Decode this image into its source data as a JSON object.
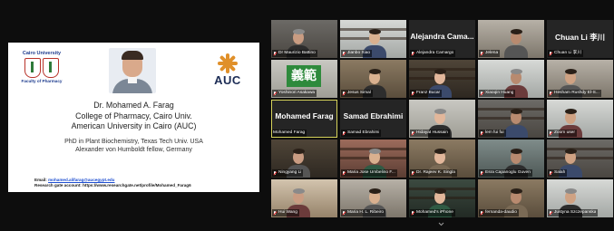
{
  "slide": {
    "cairo_logo_top": "Cairo University",
    "cairo_logo_bottom": "Faculty of Pharmacy",
    "auc_logo": "AUC",
    "name": "Dr. Mohamed A. Farag",
    "affil1": "College of Pharmacy, Cairo Univ.",
    "affil2": "American University in Cairo (AUC)",
    "edu1": "PhD in Plant Biochemistry, Texas Tech Univ. USA",
    "edu2": "Alexander von Humboldt fellow, Germany",
    "email_label": "Email:",
    "email": "mohamed.alifarag@aucegypt.edu",
    "research_label": "Research gate account:",
    "research_url": "https://www.researchgate.net/profile/Mohamed_Farag6"
  },
  "tiles": [
    {
      "name": "Dr Maurizio Battino",
      "display_name": "",
      "muted": true
    },
    {
      "name": "Jianbo Xiao",
      "display_name": "",
      "muted": true
    },
    {
      "name": "Alejandra Camargo",
      "display_name": "Alejandra Cama...",
      "muted": true
    },
    {
      "name": "Jelena",
      "display_name": "",
      "muted": true
    },
    {
      "name": "Chuan Li 李川",
      "display_name": "Chuan Li 李川",
      "muted": true
    },
    {
      "name": "Yoshinori Asakawa",
      "display_name": "",
      "muted": true,
      "sign_text": "義範"
    },
    {
      "name": "Jesus Simal",
      "display_name": "",
      "muted": true
    },
    {
      "name": "Franz Bucar",
      "display_name": "",
      "muted": true
    },
    {
      "name": "Xiaoqin Huang",
      "display_name": "",
      "muted": true
    },
    {
      "name": "Hesham Rushdy El-S...",
      "display_name": "",
      "muted": true
    },
    {
      "name": "Mohamed Farag",
      "display_name": "Mohamed Farag",
      "muted": false,
      "active": true
    },
    {
      "name": "Samad Ebrahimi",
      "display_name": "Samad Ebrahimi",
      "muted": true
    },
    {
      "name": "Hidayat Hussain",
      "display_name": "",
      "muted": true
    },
    {
      "name": "lem fui fui",
      "display_name": "",
      "muted": true
    },
    {
      "name": "Zoom user",
      "display_name": "",
      "muted": true
    },
    {
      "name": "Ningyang Li",
      "display_name": "",
      "muted": true
    },
    {
      "name": "Maria Jose Umbelino F...",
      "display_name": "",
      "muted": true
    },
    {
      "name": "Dr. Rajeev K. Singla",
      "display_name": "",
      "muted": true
    },
    {
      "name": "Esra Capanoglu Guven",
      "display_name": "",
      "muted": true
    },
    {
      "name": "Salah",
      "display_name": "",
      "muted": true
    },
    {
      "name": "Hui Wang",
      "display_name": "",
      "muted": true
    },
    {
      "name": "Maria H. L. Ribeiro",
      "display_name": "",
      "muted": true
    },
    {
      "name": "Mohamed's iPhone",
      "display_name": "",
      "muted": true
    },
    {
      "name": "fernanda-daudio",
      "display_name": "",
      "muted": true
    },
    {
      "name": "Justyna Szczepanska",
      "display_name": "",
      "muted": true
    }
  ],
  "icons": {
    "mic_muted": "mic-muted-icon",
    "chevron": "chevron-down-icon"
  },
  "colors": {
    "active_border": "#d6d35a",
    "muted_mic": "#e22b2b",
    "background": "#0d0d0d"
  }
}
